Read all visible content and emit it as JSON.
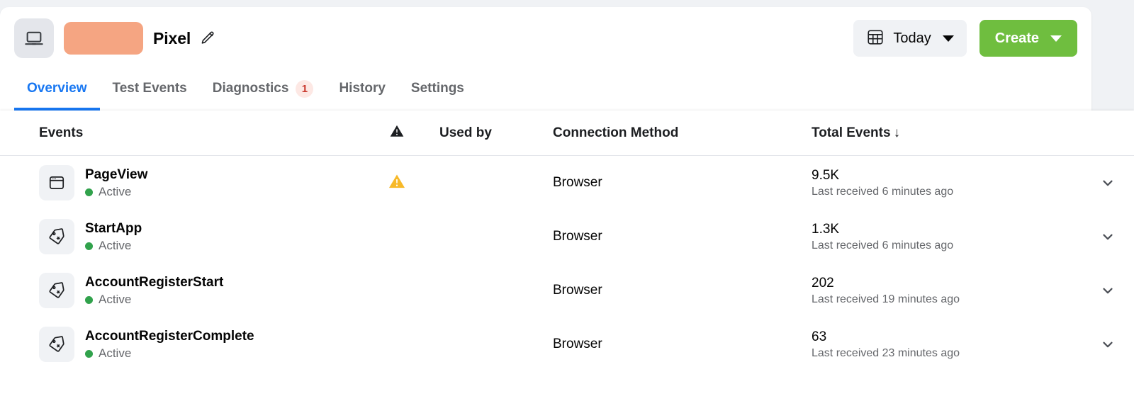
{
  "header": {
    "asset_icon": "laptop-icon",
    "redacted_label": "",
    "title": "Pixel",
    "edit_icon": "pencil-icon",
    "date_filter": {
      "icon": "calendar-icon",
      "label": "Today",
      "caret": "chevron-down-icon"
    },
    "create_button": {
      "label": "Create",
      "caret": "chevron-down-icon",
      "color": "#6fbe3f"
    }
  },
  "tabs": [
    {
      "label": "Overview",
      "active": true,
      "badge": null
    },
    {
      "label": "Test Events",
      "active": false,
      "badge": null
    },
    {
      "label": "Diagnostics",
      "active": false,
      "badge": "1"
    },
    {
      "label": "History",
      "active": false,
      "badge": null
    },
    {
      "label": "Settings",
      "active": false,
      "badge": null
    }
  ],
  "table": {
    "columns": {
      "events": "Events",
      "warning": "warning-triangle-icon",
      "used_by": "Used by",
      "connection_method": "Connection Method",
      "total_events": "Total Events",
      "sort_direction": "↓"
    },
    "rows": [
      {
        "icon": "browser-window-icon",
        "name": "PageView",
        "status": "Active",
        "warning": true,
        "used_by": "",
        "connection_method": "Browser",
        "total": "9.5K",
        "last_received": "Last received 6 minutes ago"
      },
      {
        "icon": "tag-icon",
        "name": "StartApp",
        "status": "Active",
        "warning": false,
        "used_by": "",
        "connection_method": "Browser",
        "total": "1.3K",
        "last_received": "Last received 6 minutes ago"
      },
      {
        "icon": "tag-icon",
        "name": "AccountRegisterStart",
        "status": "Active",
        "warning": false,
        "used_by": "",
        "connection_method": "Browser",
        "total": "202",
        "last_received": "Last received 19 minutes ago"
      },
      {
        "icon": "tag-icon",
        "name": "AccountRegisterComplete",
        "status": "Active",
        "warning": false,
        "used_by": "",
        "connection_method": "Browser",
        "total": "63",
        "last_received": "Last received 23 minutes ago"
      }
    ]
  },
  "colors": {
    "accent_blue": "#1877f2",
    "create_green": "#6fbe3f",
    "status_green": "#31a24c",
    "warning_amber": "#f7b928",
    "badge_red": "#c9372c",
    "redaction": "#f5a582"
  }
}
